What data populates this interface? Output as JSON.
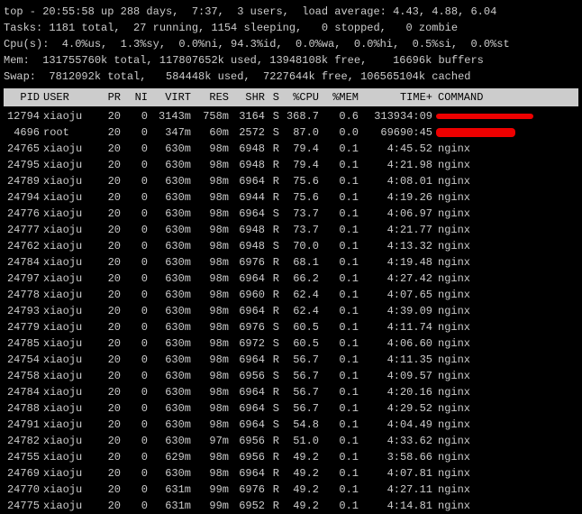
{
  "header": {
    "line1": "top - 20:55:58 up 288 days,  7:37,  3 users,  load average: 4.43, 4.88, 6.04",
    "line2": "Tasks: 1181 total,  27 running, 1154 sleeping,   0 stopped,   0 zombie",
    "line3": "Cpu(s):  4.0%us,  1.3%sy,  0.0%ni, 94.3%id,  0.0%wa,  0.0%hi,  0.5%si,  0.0%st",
    "line4": "Mem:  131755760k total, 117807652k used, 13948108k free,    16696k buffers",
    "line5": "Swap:  7812092k total,   584448k used,  7227644k free, 106565104k cached"
  },
  "columns": {
    "pid": "PID",
    "user": "USER",
    "pr": "PR",
    "ni": "NI",
    "virt": "VIRT",
    "res": "RES",
    "shr": "SHR",
    "s": "S",
    "cpu": "%CPU",
    "mem": "%MEM",
    "time": "TIME+",
    "cmd": "COMMAND"
  },
  "rows": [
    {
      "pid": "12794",
      "user": "xiaoju",
      "pr": "20",
      "ni": "0",
      "virt": "3143m",
      "res": "758m",
      "shr": "3164",
      "s": "S",
      "cpu": "368.7",
      "mem": "0.6",
      "time": "313934:09",
      "cmd": "",
      "redact": 1
    },
    {
      "pid": "4696",
      "user": "root",
      "pr": "20",
      "ni": "0",
      "virt": "347m",
      "res": "60m",
      "shr": "2572",
      "s": "S",
      "cpu": "87.0",
      "mem": "0.0",
      "time": "69690:45",
      "cmd": "",
      "redact": 2
    },
    {
      "pid": "24765",
      "user": "xiaoju",
      "pr": "20",
      "ni": "0",
      "virt": "630m",
      "res": "98m",
      "shr": "6948",
      "s": "R",
      "cpu": "79.4",
      "mem": "0.1",
      "time": "4:45.52",
      "cmd": "nginx"
    },
    {
      "pid": "24795",
      "user": "xiaoju",
      "pr": "20",
      "ni": "0",
      "virt": "630m",
      "res": "98m",
      "shr": "6948",
      "s": "R",
      "cpu": "79.4",
      "mem": "0.1",
      "time": "4:21.98",
      "cmd": "nginx"
    },
    {
      "pid": "24789",
      "user": "xiaoju",
      "pr": "20",
      "ni": "0",
      "virt": "630m",
      "res": "98m",
      "shr": "6964",
      "s": "R",
      "cpu": "75.6",
      "mem": "0.1",
      "time": "4:08.01",
      "cmd": "nginx"
    },
    {
      "pid": "24794",
      "user": "xiaoju",
      "pr": "20",
      "ni": "0",
      "virt": "630m",
      "res": "98m",
      "shr": "6944",
      "s": "R",
      "cpu": "75.6",
      "mem": "0.1",
      "time": "4:19.26",
      "cmd": "nginx"
    },
    {
      "pid": "24776",
      "user": "xiaoju",
      "pr": "20",
      "ni": "0",
      "virt": "630m",
      "res": "98m",
      "shr": "6964",
      "s": "S",
      "cpu": "73.7",
      "mem": "0.1",
      "time": "4:06.97",
      "cmd": "nginx"
    },
    {
      "pid": "24777",
      "user": "xiaoju",
      "pr": "20",
      "ni": "0",
      "virt": "630m",
      "res": "98m",
      "shr": "6948",
      "s": "R",
      "cpu": "73.7",
      "mem": "0.1",
      "time": "4:21.77",
      "cmd": "nginx"
    },
    {
      "pid": "24762",
      "user": "xiaoju",
      "pr": "20",
      "ni": "0",
      "virt": "630m",
      "res": "98m",
      "shr": "6948",
      "s": "S",
      "cpu": "70.0",
      "mem": "0.1",
      "time": "4:13.32",
      "cmd": "nginx"
    },
    {
      "pid": "24784",
      "user": "xiaoju",
      "pr": "20",
      "ni": "0",
      "virt": "630m",
      "res": "98m",
      "shr": "6976",
      "s": "R",
      "cpu": "68.1",
      "mem": "0.1",
      "time": "4:19.48",
      "cmd": "nginx"
    },
    {
      "pid": "24797",
      "user": "xiaoju",
      "pr": "20",
      "ni": "0",
      "virt": "630m",
      "res": "98m",
      "shr": "6964",
      "s": "R",
      "cpu": "66.2",
      "mem": "0.1",
      "time": "4:27.42",
      "cmd": "nginx"
    },
    {
      "pid": "24778",
      "user": "xiaoju",
      "pr": "20",
      "ni": "0",
      "virt": "630m",
      "res": "98m",
      "shr": "6960",
      "s": "R",
      "cpu": "62.4",
      "mem": "0.1",
      "time": "4:07.65",
      "cmd": "nginx"
    },
    {
      "pid": "24793",
      "user": "xiaoju",
      "pr": "20",
      "ni": "0",
      "virt": "630m",
      "res": "98m",
      "shr": "6964",
      "s": "R",
      "cpu": "62.4",
      "mem": "0.1",
      "time": "4:39.09",
      "cmd": "nginx"
    },
    {
      "pid": "24779",
      "user": "xiaoju",
      "pr": "20",
      "ni": "0",
      "virt": "630m",
      "res": "98m",
      "shr": "6976",
      "s": "S",
      "cpu": "60.5",
      "mem": "0.1",
      "time": "4:11.74",
      "cmd": "nginx"
    },
    {
      "pid": "24785",
      "user": "xiaoju",
      "pr": "20",
      "ni": "0",
      "virt": "630m",
      "res": "98m",
      "shr": "6972",
      "s": "S",
      "cpu": "60.5",
      "mem": "0.1",
      "time": "4:06.60",
      "cmd": "nginx"
    },
    {
      "pid": "24754",
      "user": "xiaoju",
      "pr": "20",
      "ni": "0",
      "virt": "630m",
      "res": "98m",
      "shr": "6964",
      "s": "R",
      "cpu": "56.7",
      "mem": "0.1",
      "time": "4:11.35",
      "cmd": "nginx"
    },
    {
      "pid": "24758",
      "user": "xiaoju",
      "pr": "20",
      "ni": "0",
      "virt": "630m",
      "res": "98m",
      "shr": "6956",
      "s": "S",
      "cpu": "56.7",
      "mem": "0.1",
      "time": "4:09.57",
      "cmd": "nginx"
    },
    {
      "pid": "24784",
      "user": "xiaoju",
      "pr": "20",
      "ni": "0",
      "virt": "630m",
      "res": "98m",
      "shr": "6964",
      "s": "R",
      "cpu": "56.7",
      "mem": "0.1",
      "time": "4:20.16",
      "cmd": "nginx"
    },
    {
      "pid": "24788",
      "user": "xiaoju",
      "pr": "20",
      "ni": "0",
      "virt": "630m",
      "res": "98m",
      "shr": "6964",
      "s": "S",
      "cpu": "56.7",
      "mem": "0.1",
      "time": "4:29.52",
      "cmd": "nginx"
    },
    {
      "pid": "24791",
      "user": "xiaoju",
      "pr": "20",
      "ni": "0",
      "virt": "630m",
      "res": "98m",
      "shr": "6964",
      "s": "S",
      "cpu": "54.8",
      "mem": "0.1",
      "time": "4:04.49",
      "cmd": "nginx"
    },
    {
      "pid": "24782",
      "user": "xiaoju",
      "pr": "20",
      "ni": "0",
      "virt": "630m",
      "res": "97m",
      "shr": "6956",
      "s": "R",
      "cpu": "51.0",
      "mem": "0.1",
      "time": "4:33.62",
      "cmd": "nginx"
    },
    {
      "pid": "24755",
      "user": "xiaoju",
      "pr": "20",
      "ni": "0",
      "virt": "629m",
      "res": "98m",
      "shr": "6956",
      "s": "R",
      "cpu": "49.2",
      "mem": "0.1",
      "time": "3:58.66",
      "cmd": "nginx"
    },
    {
      "pid": "24769",
      "user": "xiaoju",
      "pr": "20",
      "ni": "0",
      "virt": "630m",
      "res": "98m",
      "shr": "6964",
      "s": "R",
      "cpu": "49.2",
      "mem": "0.1",
      "time": "4:07.81",
      "cmd": "nginx"
    },
    {
      "pid": "24770",
      "user": "xiaoju",
      "pr": "20",
      "ni": "0",
      "virt": "631m",
      "res": "99m",
      "shr": "6976",
      "s": "R",
      "cpu": "49.2",
      "mem": "0.1",
      "time": "4:27.11",
      "cmd": "nginx"
    },
    {
      "pid": "24775",
      "user": "xiaoju",
      "pr": "20",
      "ni": "0",
      "virt": "631m",
      "res": "99m",
      "shr": "6952",
      "s": "R",
      "cpu": "49.2",
      "mem": "0.1",
      "time": "4:14.81",
      "cmd": "nginx"
    }
  ]
}
